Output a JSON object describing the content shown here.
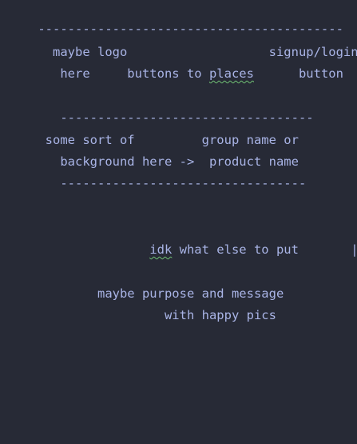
{
  "editor": {
    "lines": [
      "-----------------------------------------",
      "  maybe logo                   signup/login|",
      "   here     buttons to ",
      "places",
      "      button  |",
      "                                           |",
      "   ----------------------------------      |",
      " some sort of         group name or        |",
      "   background here ->  product name        |",
      "   ---------------------------------       |",
      "                                           |",
      "                                           |",
      "               ",
      "idk",
      " what else to put       |",
      "                                           |",
      "        maybe purpose and message          |",
      "                 with happy pics           |",
      "                                           |",
      "                                           |",
      "                                           |",
      "                                           |",
      "                                           |",
      "-------------------------------------------|"
    ]
  }
}
